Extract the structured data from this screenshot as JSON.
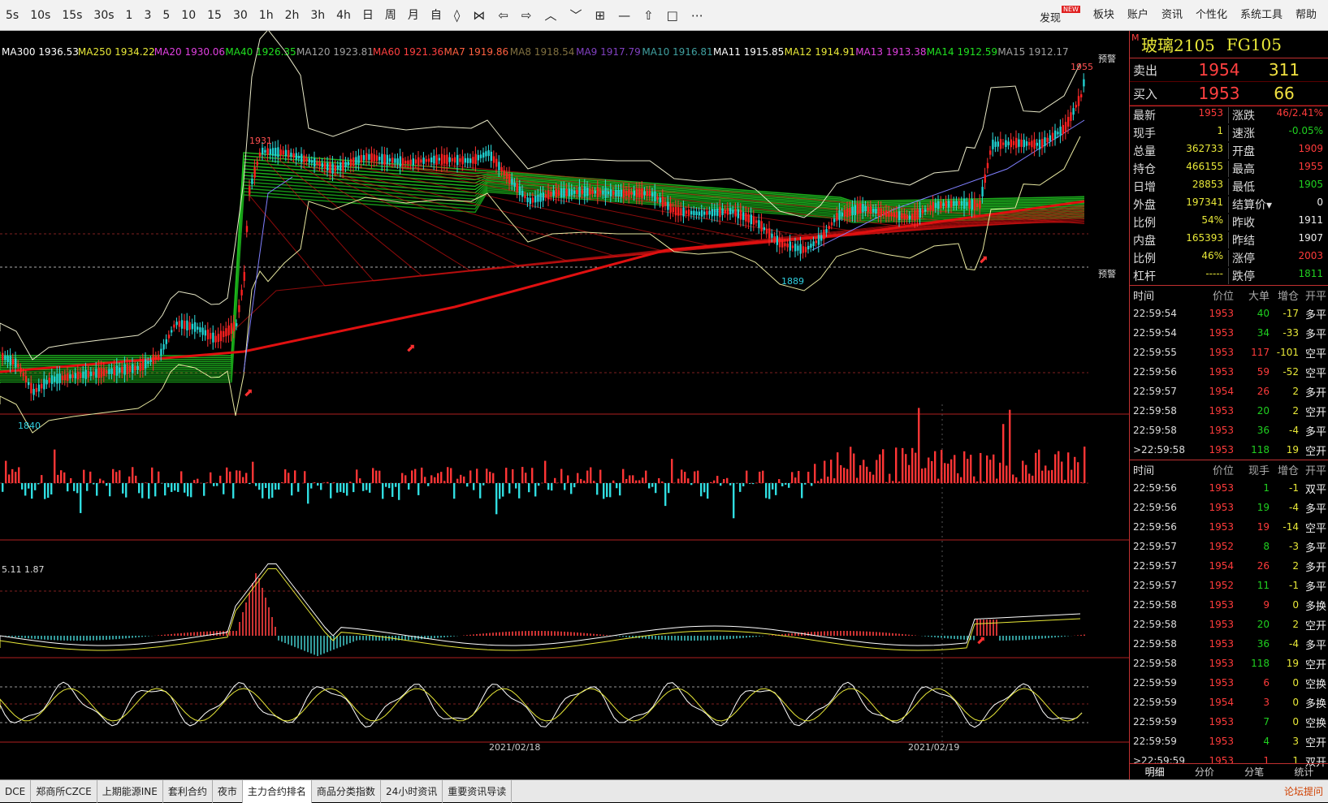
{
  "toolbar": {
    "periods": [
      "5s",
      "10s",
      "15s",
      "30s",
      "1",
      "3",
      "5",
      "10",
      "15",
      "30",
      "1h",
      "2h",
      "3h",
      "4h",
      "日",
      "周",
      "月",
      "自"
    ],
    "right_items": [
      "发现",
      "板块",
      "账户",
      "资讯",
      "个性化",
      "系统工具",
      "帮助"
    ],
    "new_badge": "NEW"
  },
  "ma_legend": [
    {
      "text": "MA300 1936.53",
      "color": "#ffffff"
    },
    {
      "text": "MA250 1934.22",
      "color": "#e8e838"
    },
    {
      "text": "MA20 1930.06",
      "color": "#e040e0"
    },
    {
      "text": "MA40 1926.35",
      "color": "#20e020"
    },
    {
      "text": "MA120 1923.81",
      "color": "#a0a0a0"
    },
    {
      "text": "MA60 1921.36",
      "color": "#ff4040"
    },
    {
      "text": "MA7 1919.86",
      "color": "#ff6040"
    },
    {
      "text": "MA8 1918.54",
      "color": "#807040"
    },
    {
      "text": "MA9 1917.79",
      "color": "#8040c0"
    },
    {
      "text": "MA10 1916.81",
      "color": "#40a0a0"
    },
    {
      "text": "MA11 1915.85",
      "color": "#ffffff"
    },
    {
      "text": "MA12 1914.91",
      "color": "#e8e838"
    },
    {
      "text": "MA13 1913.38",
      "color": "#e040e0"
    },
    {
      "text": "MA14 1912.59",
      "color": "#20e020"
    },
    {
      "text": "MA15 1912.17",
      "color": "#a0a0a0"
    }
  ],
  "chart_labels": {
    "price_high": "1931",
    "price_low_left": "1840",
    "price_low_mid": "1889",
    "price_last_high": "1955",
    "alert_top": "预警",
    "alert_bottom": "预警",
    "indicator_values": "5.11   1.87",
    "date1": "2021/02/18",
    "date2": "2021/02/19"
  },
  "instrument": {
    "name": "玻璃2105",
    "code": "FG105",
    "marker": "M"
  },
  "quote": {
    "ask_label": "卖出",
    "ask_price": "1954",
    "ask_vol": "311",
    "bid_label": "买入",
    "bid_price": "1953",
    "bid_vol": "66"
  },
  "stats": [
    {
      "k1": "最新",
      "v1": "1953",
      "c1": "red",
      "k2": "涨跌",
      "v2": "46/2.41%",
      "c2": "red"
    },
    {
      "k1": "现手",
      "v1": "1",
      "c1": "yellow",
      "k2": "速涨",
      "v2": "-0.05%",
      "c2": "green"
    },
    {
      "k1": "总量",
      "v1": "362733",
      "c1": "yellow",
      "k2": "开盘",
      "v2": "1909",
      "c2": "red"
    },
    {
      "k1": "持仓",
      "v1": "466155",
      "c1": "yellow",
      "k2": "最高",
      "v2": "1955",
      "c2": "red"
    },
    {
      "k1": "日增",
      "v1": "28853",
      "c1": "yellow",
      "k2": "最低",
      "v2": "1905",
      "c2": "green"
    },
    {
      "k1": "外盘",
      "v1": "197341",
      "c1": "yellow",
      "k2": "结算价▾",
      "v2": "0",
      "c2": "white"
    },
    {
      "k1": "比例",
      "v1": "54%",
      "c1": "yellow",
      "k2": "昨收",
      "v2": "1911",
      "c2": "white"
    },
    {
      "k1": "内盘",
      "v1": "165393",
      "c1": "yellow",
      "k2": "昨结",
      "v2": "1907",
      "c2": "white"
    },
    {
      "k1": "比例",
      "v1": "46%",
      "c1": "yellow",
      "k2": "涨停",
      "v2": "2003",
      "c2": "red"
    },
    {
      "k1": "杠杆",
      "v1": "-----",
      "c1": "yellow",
      "k2": "跌停",
      "v2": "1811",
      "c2": "green"
    }
  ],
  "big_orders": {
    "headers": [
      "时间",
      "价位",
      "大单",
      "增仓",
      "开平"
    ],
    "rows": [
      {
        "t": "22:59:54",
        "p": "1953",
        "pc": "red",
        "q": "40",
        "qc": "green",
        "o": "-17",
        "oc": "yellow",
        "k": "多平"
      },
      {
        "t": "22:59:54",
        "p": "1953",
        "pc": "red",
        "q": "34",
        "qc": "green",
        "o": "-33",
        "oc": "yellow",
        "k": "多平"
      },
      {
        "t": "22:59:55",
        "p": "1953",
        "pc": "red",
        "q": "117",
        "qc": "red",
        "o": "-101",
        "oc": "yellow",
        "k": "空平"
      },
      {
        "t": "22:59:56",
        "p": "1953",
        "pc": "red",
        "q": "59",
        "qc": "red",
        "o": "-52",
        "oc": "yellow",
        "k": "空平"
      },
      {
        "t": "22:59:57",
        "p": "1954",
        "pc": "red",
        "q": "26",
        "qc": "red",
        "o": "2",
        "oc": "yellow",
        "k": "多开"
      },
      {
        "t": "22:59:58",
        "p": "1953",
        "pc": "red",
        "q": "20",
        "qc": "green",
        "o": "2",
        "oc": "yellow",
        "k": "空开"
      },
      {
        "t": "22:59:58",
        "p": "1953",
        "pc": "red",
        "q": "36",
        "qc": "green",
        "o": "-4",
        "oc": "yellow",
        "k": "多平"
      },
      {
        "t": ">22:59:58",
        "p": "1953",
        "pc": "red",
        "q": "118",
        "qc": "green",
        "o": "19",
        "oc": "yellow",
        "k": "空开"
      }
    ]
  },
  "ticks": {
    "headers": [
      "时间",
      "价位",
      "现手",
      "增仓",
      "开平"
    ],
    "rows": [
      {
        "t": "22:59:56",
        "p": "1953",
        "pc": "red",
        "q": "1",
        "qc": "green",
        "o": "-1",
        "oc": "yellow",
        "k": "双平"
      },
      {
        "t": "22:59:56",
        "p": "1953",
        "pc": "red",
        "q": "19",
        "qc": "green",
        "o": "-4",
        "oc": "yellow",
        "k": "多平"
      },
      {
        "t": "22:59:56",
        "p": "1953",
        "pc": "red",
        "q": "19",
        "qc": "red",
        "o": "-14",
        "oc": "yellow",
        "k": "空平"
      },
      {
        "t": "22:59:57",
        "p": "1952",
        "pc": "red",
        "q": "8",
        "qc": "green",
        "o": "-3",
        "oc": "yellow",
        "k": "多平"
      },
      {
        "t": "22:59:57",
        "p": "1954",
        "pc": "red",
        "q": "26",
        "qc": "red",
        "o": "2",
        "oc": "yellow",
        "k": "多开"
      },
      {
        "t": "22:59:57",
        "p": "1952",
        "pc": "red",
        "q": "11",
        "qc": "green",
        "o": "-1",
        "oc": "yellow",
        "k": "多平"
      },
      {
        "t": "22:59:58",
        "p": "1953",
        "pc": "red",
        "q": "9",
        "qc": "red",
        "o": "0",
        "oc": "yellow",
        "k": "多换"
      },
      {
        "t": "22:59:58",
        "p": "1953",
        "pc": "red",
        "q": "20",
        "qc": "green",
        "o": "2",
        "oc": "yellow",
        "k": "空开"
      },
      {
        "t": "22:59:58",
        "p": "1953",
        "pc": "red",
        "q": "36",
        "qc": "green",
        "o": "-4",
        "oc": "yellow",
        "k": "多平"
      },
      {
        "t": "22:59:58",
        "p": "1953",
        "pc": "red",
        "q": "118",
        "qc": "green",
        "o": "19",
        "oc": "yellow",
        "k": "空开"
      },
      {
        "t": "22:59:59",
        "p": "1953",
        "pc": "red",
        "q": "6",
        "qc": "red",
        "o": "0",
        "oc": "yellow",
        "k": "空换"
      },
      {
        "t": "22:59:59",
        "p": "1954",
        "pc": "red",
        "q": "3",
        "qc": "red",
        "o": "0",
        "oc": "yellow",
        "k": "多换"
      },
      {
        "t": "22:59:59",
        "p": "1953",
        "pc": "red",
        "q": "7",
        "qc": "green",
        "o": "0",
        "oc": "yellow",
        "k": "空换"
      },
      {
        "t": "22:59:59",
        "p": "1953",
        "pc": "red",
        "q": "4",
        "qc": "green",
        "o": "3",
        "oc": "yellow",
        "k": "空开"
      },
      {
        "t": ">22:59:59",
        "p": "1953",
        "pc": "red",
        "q": "1",
        "qc": "red",
        "o": "1",
        "oc": "yellow",
        "k": "双开"
      }
    ]
  },
  "right_tabs": [
    "明细",
    "分价",
    "分笔",
    "统计"
  ],
  "bottom_tabs": [
    "DCE",
    "郑商所CZCE",
    "上期能源INE",
    "套利合约",
    "夜市",
    "主力合约排名",
    "商品分类指数",
    "24小时资讯",
    "重要资讯导读"
  ],
  "bottom_active": 5,
  "forum_label": "论坛提问",
  "colors": {
    "up": "#ff3b3b",
    "down": "#30e0e0",
    "ma_fan_green": "#20c020",
    "ma_fan_red": "#d01010",
    "panel_border": "#c03030"
  }
}
